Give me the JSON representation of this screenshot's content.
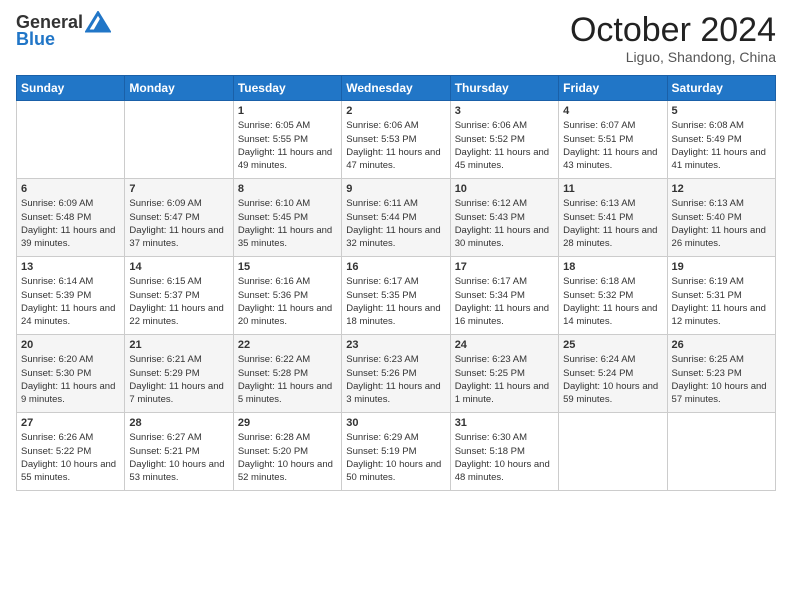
{
  "header": {
    "logo_general": "General",
    "logo_blue": "Blue",
    "month": "October 2024",
    "location": "Liguo, Shandong, China"
  },
  "days_of_week": [
    "Sunday",
    "Monday",
    "Tuesday",
    "Wednesday",
    "Thursday",
    "Friday",
    "Saturday"
  ],
  "weeks": [
    [
      {
        "day": "",
        "sunrise": "",
        "sunset": "",
        "daylight": ""
      },
      {
        "day": "",
        "sunrise": "",
        "sunset": "",
        "daylight": ""
      },
      {
        "day": "1",
        "sunrise": "Sunrise: 6:05 AM",
        "sunset": "Sunset: 5:55 PM",
        "daylight": "Daylight: 11 hours and 49 minutes."
      },
      {
        "day": "2",
        "sunrise": "Sunrise: 6:06 AM",
        "sunset": "Sunset: 5:53 PM",
        "daylight": "Daylight: 11 hours and 47 minutes."
      },
      {
        "day": "3",
        "sunrise": "Sunrise: 6:06 AM",
        "sunset": "Sunset: 5:52 PM",
        "daylight": "Daylight: 11 hours and 45 minutes."
      },
      {
        "day": "4",
        "sunrise": "Sunrise: 6:07 AM",
        "sunset": "Sunset: 5:51 PM",
        "daylight": "Daylight: 11 hours and 43 minutes."
      },
      {
        "day": "5",
        "sunrise": "Sunrise: 6:08 AM",
        "sunset": "Sunset: 5:49 PM",
        "daylight": "Daylight: 11 hours and 41 minutes."
      }
    ],
    [
      {
        "day": "6",
        "sunrise": "Sunrise: 6:09 AM",
        "sunset": "Sunset: 5:48 PM",
        "daylight": "Daylight: 11 hours and 39 minutes."
      },
      {
        "day": "7",
        "sunrise": "Sunrise: 6:09 AM",
        "sunset": "Sunset: 5:47 PM",
        "daylight": "Daylight: 11 hours and 37 minutes."
      },
      {
        "day": "8",
        "sunrise": "Sunrise: 6:10 AM",
        "sunset": "Sunset: 5:45 PM",
        "daylight": "Daylight: 11 hours and 35 minutes."
      },
      {
        "day": "9",
        "sunrise": "Sunrise: 6:11 AM",
        "sunset": "Sunset: 5:44 PM",
        "daylight": "Daylight: 11 hours and 32 minutes."
      },
      {
        "day": "10",
        "sunrise": "Sunrise: 6:12 AM",
        "sunset": "Sunset: 5:43 PM",
        "daylight": "Daylight: 11 hours and 30 minutes."
      },
      {
        "day": "11",
        "sunrise": "Sunrise: 6:13 AM",
        "sunset": "Sunset: 5:41 PM",
        "daylight": "Daylight: 11 hours and 28 minutes."
      },
      {
        "day": "12",
        "sunrise": "Sunrise: 6:13 AM",
        "sunset": "Sunset: 5:40 PM",
        "daylight": "Daylight: 11 hours and 26 minutes."
      }
    ],
    [
      {
        "day": "13",
        "sunrise": "Sunrise: 6:14 AM",
        "sunset": "Sunset: 5:39 PM",
        "daylight": "Daylight: 11 hours and 24 minutes."
      },
      {
        "day": "14",
        "sunrise": "Sunrise: 6:15 AM",
        "sunset": "Sunset: 5:37 PM",
        "daylight": "Daylight: 11 hours and 22 minutes."
      },
      {
        "day": "15",
        "sunrise": "Sunrise: 6:16 AM",
        "sunset": "Sunset: 5:36 PM",
        "daylight": "Daylight: 11 hours and 20 minutes."
      },
      {
        "day": "16",
        "sunrise": "Sunrise: 6:17 AM",
        "sunset": "Sunset: 5:35 PM",
        "daylight": "Daylight: 11 hours and 18 minutes."
      },
      {
        "day": "17",
        "sunrise": "Sunrise: 6:17 AM",
        "sunset": "Sunset: 5:34 PM",
        "daylight": "Daylight: 11 hours and 16 minutes."
      },
      {
        "day": "18",
        "sunrise": "Sunrise: 6:18 AM",
        "sunset": "Sunset: 5:32 PM",
        "daylight": "Daylight: 11 hours and 14 minutes."
      },
      {
        "day": "19",
        "sunrise": "Sunrise: 6:19 AM",
        "sunset": "Sunset: 5:31 PM",
        "daylight": "Daylight: 11 hours and 12 minutes."
      }
    ],
    [
      {
        "day": "20",
        "sunrise": "Sunrise: 6:20 AM",
        "sunset": "Sunset: 5:30 PM",
        "daylight": "Daylight: 11 hours and 9 minutes."
      },
      {
        "day": "21",
        "sunrise": "Sunrise: 6:21 AM",
        "sunset": "Sunset: 5:29 PM",
        "daylight": "Daylight: 11 hours and 7 minutes."
      },
      {
        "day": "22",
        "sunrise": "Sunrise: 6:22 AM",
        "sunset": "Sunset: 5:28 PM",
        "daylight": "Daylight: 11 hours and 5 minutes."
      },
      {
        "day": "23",
        "sunrise": "Sunrise: 6:23 AM",
        "sunset": "Sunset: 5:26 PM",
        "daylight": "Daylight: 11 hours and 3 minutes."
      },
      {
        "day": "24",
        "sunrise": "Sunrise: 6:23 AM",
        "sunset": "Sunset: 5:25 PM",
        "daylight": "Daylight: 11 hours and 1 minute."
      },
      {
        "day": "25",
        "sunrise": "Sunrise: 6:24 AM",
        "sunset": "Sunset: 5:24 PM",
        "daylight": "Daylight: 10 hours and 59 minutes."
      },
      {
        "day": "26",
        "sunrise": "Sunrise: 6:25 AM",
        "sunset": "Sunset: 5:23 PM",
        "daylight": "Daylight: 10 hours and 57 minutes."
      }
    ],
    [
      {
        "day": "27",
        "sunrise": "Sunrise: 6:26 AM",
        "sunset": "Sunset: 5:22 PM",
        "daylight": "Daylight: 10 hours and 55 minutes."
      },
      {
        "day": "28",
        "sunrise": "Sunrise: 6:27 AM",
        "sunset": "Sunset: 5:21 PM",
        "daylight": "Daylight: 10 hours and 53 minutes."
      },
      {
        "day": "29",
        "sunrise": "Sunrise: 6:28 AM",
        "sunset": "Sunset: 5:20 PM",
        "daylight": "Daylight: 10 hours and 52 minutes."
      },
      {
        "day": "30",
        "sunrise": "Sunrise: 6:29 AM",
        "sunset": "Sunset: 5:19 PM",
        "daylight": "Daylight: 10 hours and 50 minutes."
      },
      {
        "day": "31",
        "sunrise": "Sunrise: 6:30 AM",
        "sunset": "Sunset: 5:18 PM",
        "daylight": "Daylight: 10 hours and 48 minutes."
      },
      {
        "day": "",
        "sunrise": "",
        "sunset": "",
        "daylight": ""
      },
      {
        "day": "",
        "sunrise": "",
        "sunset": "",
        "daylight": ""
      }
    ]
  ]
}
